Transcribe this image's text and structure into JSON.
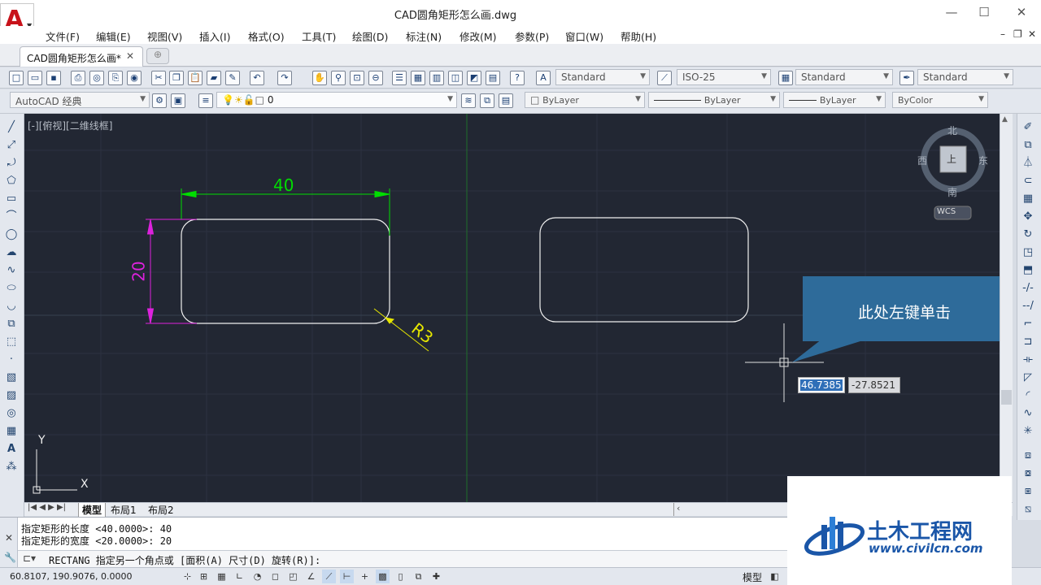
{
  "window": {
    "title": "CAD圆角矩形怎么画.dwg",
    "min": "—",
    "max": "☐",
    "close": "✕"
  },
  "menu": [
    "文件(F)",
    "编辑(E)",
    "视图(V)",
    "插入(I)",
    "格式(O)",
    "工具(T)",
    "绘图(D)",
    "标注(N)",
    "修改(M)",
    "参数(P)",
    "窗口(W)",
    "帮助(H)"
  ],
  "doc_tab": {
    "label": "CAD圆角矩形怎么画*",
    "close": "✕"
  },
  "styles": {
    "text": "Standard",
    "dim": "ISO-25",
    "table": "Standard",
    "mleader": "Standard"
  },
  "workspace": "AutoCAD 经典",
  "layer": "0",
  "props": {
    "color": "ByLayer",
    "linetype": "ByLayer",
    "lineweight": "ByLayer",
    "plotstyle": "ByColor"
  },
  "viewport_label": "[-][俯视][二维线框]",
  "viewcube": {
    "north": "北",
    "south": "南",
    "east": "东",
    "west": "西",
    "top": "上",
    "wcs": "WCS"
  },
  "drawing": {
    "dim_width": "40",
    "dim_height": "20",
    "radius": "R3"
  },
  "ucs": {
    "y": "Y",
    "x": "X"
  },
  "tooltip": "此处左键单击",
  "dynamic_input": {
    "x": "46.7385",
    "y": "-27.8521"
  },
  "layout_tabs": [
    "模型",
    "布局1",
    "布局2"
  ],
  "command": {
    "history": [
      "指定矩形的长度 <40.0000>: 40",
      "指定矩形的宽度 <20.0000>: 20"
    ],
    "prompt": "RECTANG 指定另一个角点或 [面积(A) 尺寸(D) 旋转(R)]:"
  },
  "status": {
    "coords": "60.8107,  190.9076,  0.0000",
    "model": "模型"
  },
  "watermark": {
    "name": "土木工程网",
    "url": "www.civilcn.com"
  },
  "colors": {
    "canvas": "#222733",
    "dim_green": "#00dd00",
    "dim_magenta": "#dd22dd",
    "radius_yellow": "#e6e600",
    "tooltip": "#2e6b9a"
  }
}
